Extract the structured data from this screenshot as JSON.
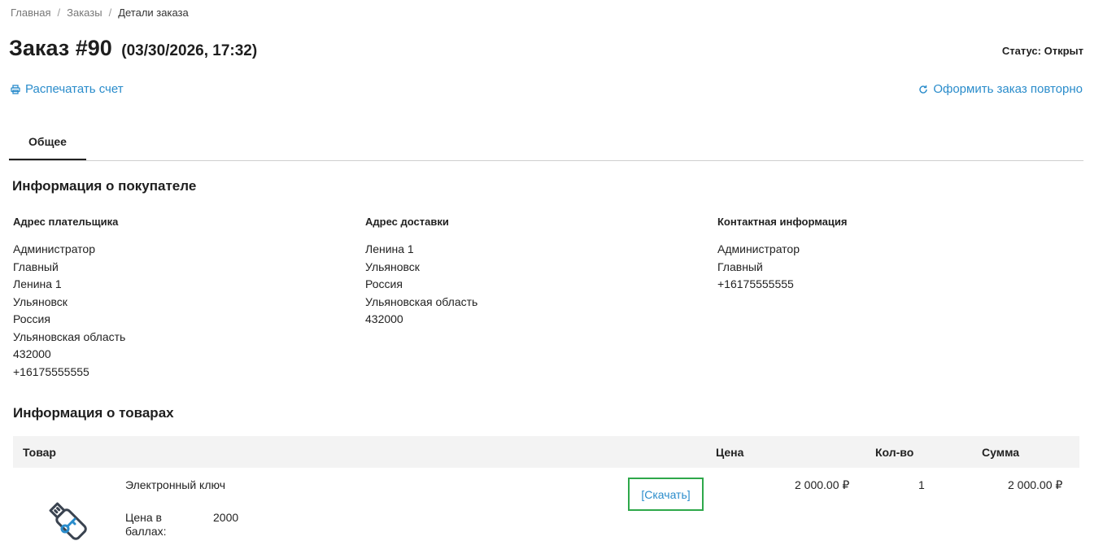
{
  "breadcrumb": {
    "items": [
      "Главная",
      "Заказы"
    ],
    "current": "Детали заказа"
  },
  "order": {
    "title": "Заказ #90",
    "date": "(03/30/2026, 17:32)",
    "status": "Статус: Открыт"
  },
  "actions": {
    "print": "Распечатать счет",
    "reorder": "Оформить заказ повторно"
  },
  "tabs": [
    {
      "label": "Общее",
      "active": true
    }
  ],
  "customer": {
    "heading": "Информация о покупателе",
    "billing": {
      "heading": "Адрес плательщика",
      "lines": [
        "Администратор",
        "Главный",
        "Ленина 1",
        "Ульяновск",
        "Россия",
        "Ульяновская область",
        "432000",
        "+16175555555"
      ]
    },
    "shipping": {
      "heading": "Адрес доставки",
      "lines": [
        "Ленина 1",
        "Ульяновск",
        "Россия",
        "Ульяновская область",
        "432000"
      ]
    },
    "contact": {
      "heading": "Контактная информация",
      "lines": [
        "Администратор",
        "Главный",
        "+16175555555"
      ]
    }
  },
  "products": {
    "heading": "Информация о товарах",
    "columns": {
      "product": "Товар",
      "price": "Цена",
      "qty": "Кол-во",
      "total": "Сумма"
    },
    "items": [
      {
        "name": "Электронный ключ",
        "points_label": "Цена в баллах:",
        "points": "2000",
        "download": "[Скачать]",
        "price": "2 000.00 ₽",
        "qty": "1",
        "total": "2 000.00 ₽",
        "icon": "usb-key-icon"
      }
    ]
  },
  "colors": {
    "link": "#2a8ccb",
    "highlight": "#2ea84a",
    "header_bg": "#f3f3f3"
  }
}
